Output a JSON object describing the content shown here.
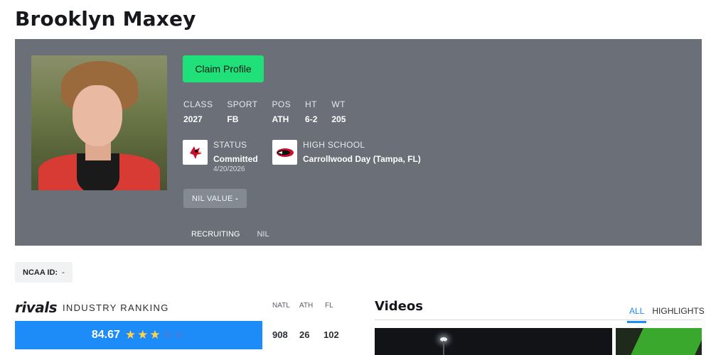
{
  "page": {
    "title": "Brooklyn Maxey"
  },
  "profile": {
    "claim_label": "Claim Profile",
    "stats": [
      {
        "label": "CLASS",
        "value": "2027"
      },
      {
        "label": "SPORT",
        "value": "FB"
      },
      {
        "label": "POS",
        "value": "ATH"
      },
      {
        "label": "HT",
        "value": "6-2"
      },
      {
        "label": "WT",
        "value": "205"
      }
    ],
    "status": {
      "label": "STATUS",
      "value": "Committed",
      "date": "4/20/2026",
      "logo_icon": "cardinal-logo-icon"
    },
    "school": {
      "label": "HIGH SCHOOL",
      "value": "Carrollwood Day (Tampa, FL)",
      "logo_icon": "patriot-logo-icon"
    },
    "nil": {
      "label": "NIL VALUE",
      "value": "-"
    },
    "tabs": [
      {
        "label": "RECRUITING",
        "active": true
      },
      {
        "label": "NIL",
        "active": false
      }
    ]
  },
  "ncaa": {
    "label": "NCAA ID:",
    "value": "-"
  },
  "ranking": {
    "brand": "rivals",
    "subtitle": "INDUSTRY RANKING",
    "score": "84.67",
    "stars_on": 3,
    "stars_total": 5,
    "columns": [
      "NATL",
      "ATH",
      "FL"
    ],
    "values": [
      "908",
      "26",
      "102"
    ],
    "colors": {
      "bar": "#1d8cf8",
      "star_on": "#ffd24a"
    }
  },
  "videos": {
    "title": "Videos",
    "tabs": [
      {
        "label": "ALL",
        "active": true
      },
      {
        "label": "HIGHLIGHTS",
        "active": false
      }
    ]
  },
  "colors": {
    "hero_bg": "#6b7078",
    "claim_btn": "#1fe079",
    "accent": "#1d8cf8"
  }
}
